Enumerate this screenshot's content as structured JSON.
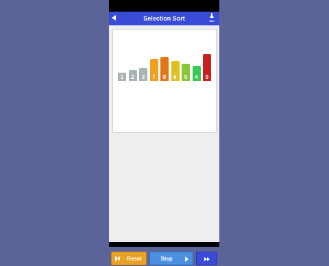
{
  "app": {
    "title": "Selection Sort",
    "sim_label": "Sim"
  },
  "chart_data": {
    "type": "bar",
    "categories": [
      "1",
      "2",
      "3",
      "7",
      "8",
      "6",
      "5",
      "4",
      "9"
    ],
    "values": [
      1,
      2,
      3,
      7,
      8,
      6,
      5,
      4,
      9
    ],
    "colors": [
      "#a8b4b4",
      "#a8b4b4",
      "#a8b4b4",
      "#f0a020",
      "#e07818",
      "#e0c020",
      "#88c838",
      "#38c858",
      "#c82020"
    ]
  },
  "controls": {
    "reset_label": "Reset",
    "step_label": "Step"
  },
  "icons": {
    "back": "back-arrow-icon",
    "sim": "flask-icon",
    "reset": "skip-back-icon",
    "step": "play-icon",
    "fast_forward": "fast-forward-icon"
  }
}
